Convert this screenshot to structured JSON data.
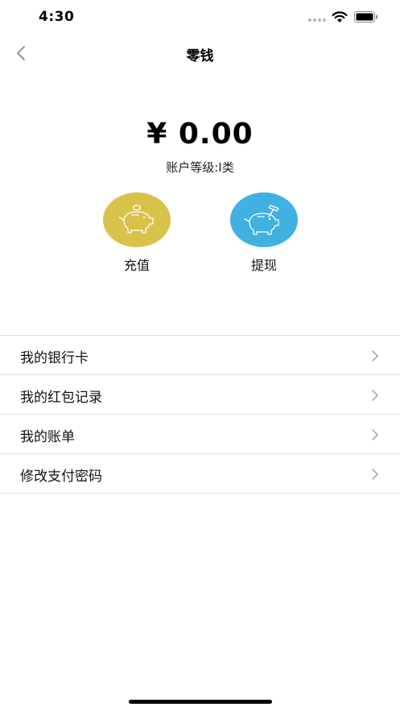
{
  "status_bar": {
    "time": "4:30"
  },
  "nav": {
    "title": "零钱"
  },
  "balance": {
    "amount": "¥ 0.00",
    "level": "账户等级:I类"
  },
  "actions": [
    {
      "label": "充值",
      "icon": "piggy-bank-coin-icon",
      "color": "#d9c24a"
    },
    {
      "label": "提现",
      "icon": "piggy-bank-hammer-icon",
      "color": "#40b1e1"
    }
  ],
  "menu": {
    "items": [
      {
        "label": "我的银行卡"
      },
      {
        "label": "我的红包记录"
      },
      {
        "label": "我的账单"
      },
      {
        "label": "修改支付密码"
      }
    ]
  },
  "colors": {
    "divider": "#dedede",
    "chevron": "#a9a9a9"
  }
}
